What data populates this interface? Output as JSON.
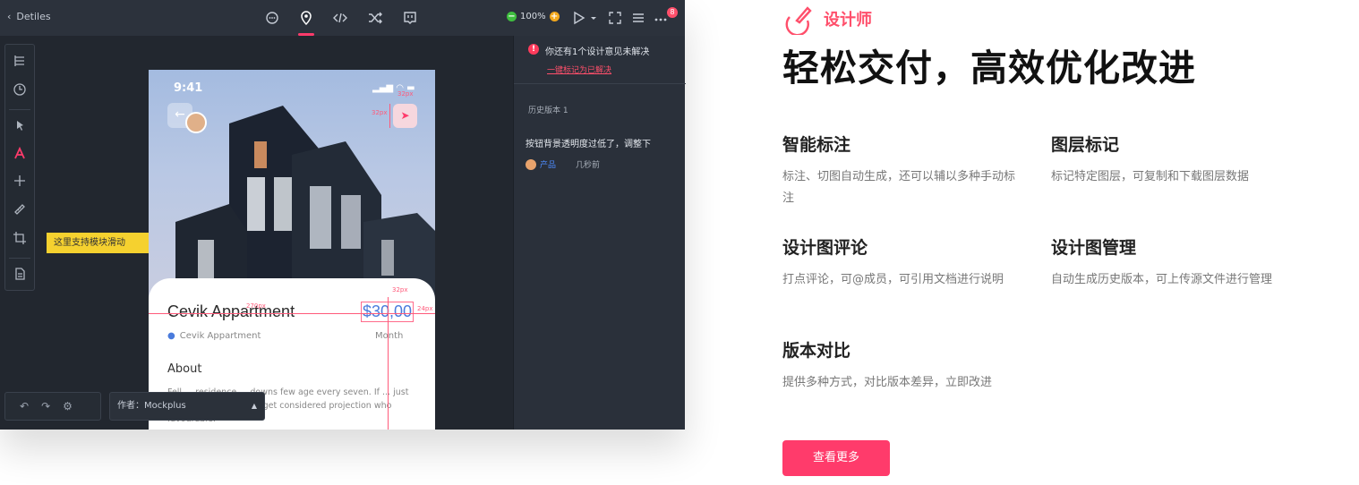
{
  "app": {
    "back_label": "Detiles",
    "zoom": "100%",
    "notification_count": "8",
    "tooltip": "这里支持模块滑动",
    "author": "作者：Mockplus",
    "colors": {
      "accent": "#ff3b6b",
      "bg": "#22272f"
    }
  },
  "phone": {
    "time": "9:41",
    "title": "Cevik Appartment",
    "price": "$30,00",
    "location": "Cevik Appartment",
    "price_unit": "Month",
    "about_heading": "About",
    "description": "Fell ... residence ... downs few age every seven. If ... just shew. Discovered had get considered projection who favourable.",
    "measures": {
      "a": "32px",
      "b": "32px",
      "c": "270px",
      "d": "32px",
      "e": "24px"
    }
  },
  "panel": {
    "warning": "你还有1个设计意见未解决",
    "resolve_link": "一键标记为已解决",
    "history": "历史版本 1",
    "comment": "按钮背景透明度过低了，调整下",
    "comment_author": "产品",
    "comment_time": "几秒前"
  },
  "info": {
    "role": "设计师",
    "headline": "轻松交付，高效优化改进",
    "features": [
      {
        "title": "智能标注",
        "desc": "标注、切图自动生成，还可以辅以多种手动标注"
      },
      {
        "title": "图层标记",
        "desc": "标记特定图层，可复制和下载图层数据"
      },
      {
        "title": "设计图评论",
        "desc": "打点评论，可@成员，可引用文档进行说明"
      },
      {
        "title": "设计图管理",
        "desc": "自动生成历史版本，可上传源文件进行管理"
      },
      {
        "title": "版本对比",
        "desc": "提供多种方式，对比版本差异，立即改进"
      }
    ],
    "more_button": "查看更多"
  }
}
